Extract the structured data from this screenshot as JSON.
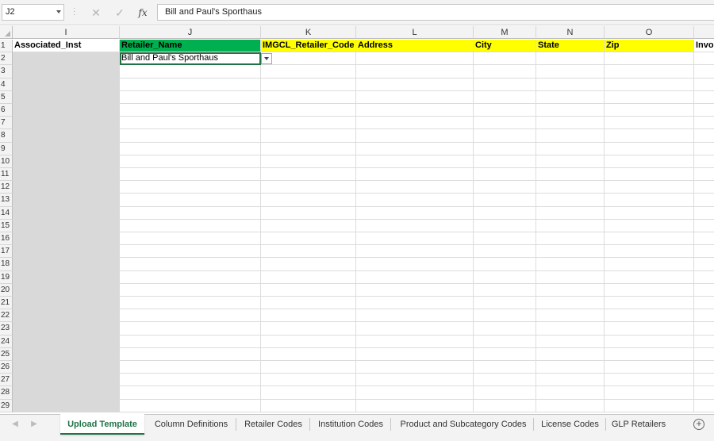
{
  "formula_bar": {
    "name_box": "J2",
    "formula": "Bill and Paul's Sporthaus"
  },
  "columns": [
    "I",
    "J",
    "K",
    "L",
    "M",
    "N",
    "O"
  ],
  "header_row": {
    "I": "Associated_Inst",
    "J": "Retailer_Name",
    "K": "IMGCL_Retailer_Code",
    "L": "Address",
    "M": "City",
    "N": "State",
    "O": "Zip",
    "P": "Invoi"
  },
  "row2": {
    "J": "Bill and Paul's Sporthaus"
  },
  "rows": [
    "1",
    "2",
    "3",
    "4",
    "5",
    "6",
    "7",
    "8",
    "9",
    "10",
    "11",
    "12",
    "13",
    "14",
    "15",
    "16",
    "17",
    "18",
    "19",
    "20",
    "21",
    "22",
    "23",
    "24",
    "25",
    "26",
    "27",
    "28",
    "29"
  ],
  "sheet_tabs": [
    "Upload Template",
    "Column Definitions",
    "Retailer Codes",
    "Institution Codes",
    "Product and Subcategory Codes",
    "License Codes",
    "GLP Retailers"
  ],
  "active_tab": "Upload Template",
  "colors": {
    "green_header": "#00b050",
    "yellow_header": "#ffff00",
    "excel_green": "#217346"
  }
}
